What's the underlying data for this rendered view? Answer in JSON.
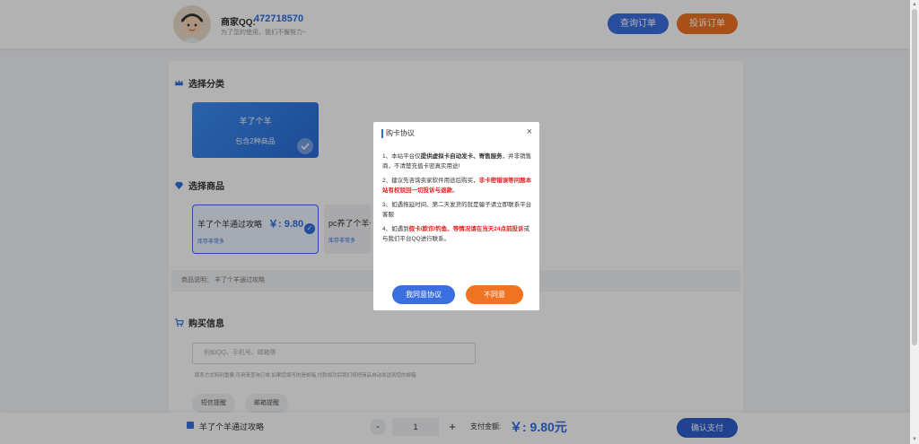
{
  "header": {
    "seller_label": "商家QQ:",
    "seller_qq": "472718570",
    "seller_sub": "为了您的使用，我们不懈努力~",
    "query_order": "查询订单",
    "complain_order": "投诉订单"
  },
  "category": {
    "title": "选择分类",
    "items": [
      {
        "name": "羊了个羊",
        "count": "包含2种商品"
      }
    ]
  },
  "product": {
    "title": "选择商品",
    "items": [
      {
        "name": "羊了个羊通过攻略",
        "price": "￥: 9.80",
        "stock": "库存非常多"
      },
      {
        "name": "pc养了个羊一",
        "stock": "库存非常多"
      }
    ],
    "description": "商品说明：  羊了个羊通过攻略"
  },
  "buy": {
    "title": "购买信息",
    "placeholder": "例如QQ、手机号、邮箱等",
    "hint": "联系方式特别重要,可用来查询订单,如果您填写的是邮箱,付款成功后我们将把商品自动发送到您的邮箱",
    "sms": "短信提醒",
    "email": "邮箱提醒"
  },
  "bottom": {
    "product_name": "羊了个羊通过攻略",
    "minus": "-",
    "quantity": "1",
    "plus": "+",
    "total_label": "支付金额:",
    "total": "￥: 9.80元",
    "confirm": "确认支付"
  },
  "modal": {
    "title": "购卡协议",
    "close": "×",
    "p1_a": "1、本站平台仅",
    "p1_b": "提供虚拟卡自动发卡、寄售服务",
    "p1_c": "，并非销售商，不清楚充值卡密真实用途!",
    "p2_a": "2、建议先咨询卖家软件用途后购买，",
    "p2_b": "非卡密错误等问题本站有权驳回一切投诉与退款",
    "p2_c": "。",
    "p3": "3、如遇拖延时间、第二天发货的就是骗子请立即联系平台客服",
    "p4_a": "4、如遇到",
    "p4_b": "假卡/欺诈/钓鱼、等情况请在当天24点前投诉",
    "p4_c": "或与我们平台QQ进行联系。",
    "agree": "我同意协议",
    "disagree": "不同意"
  },
  "colors": {
    "primary": "#3b6fe0",
    "orange": "#ef7424",
    "danger": "#e02020"
  }
}
